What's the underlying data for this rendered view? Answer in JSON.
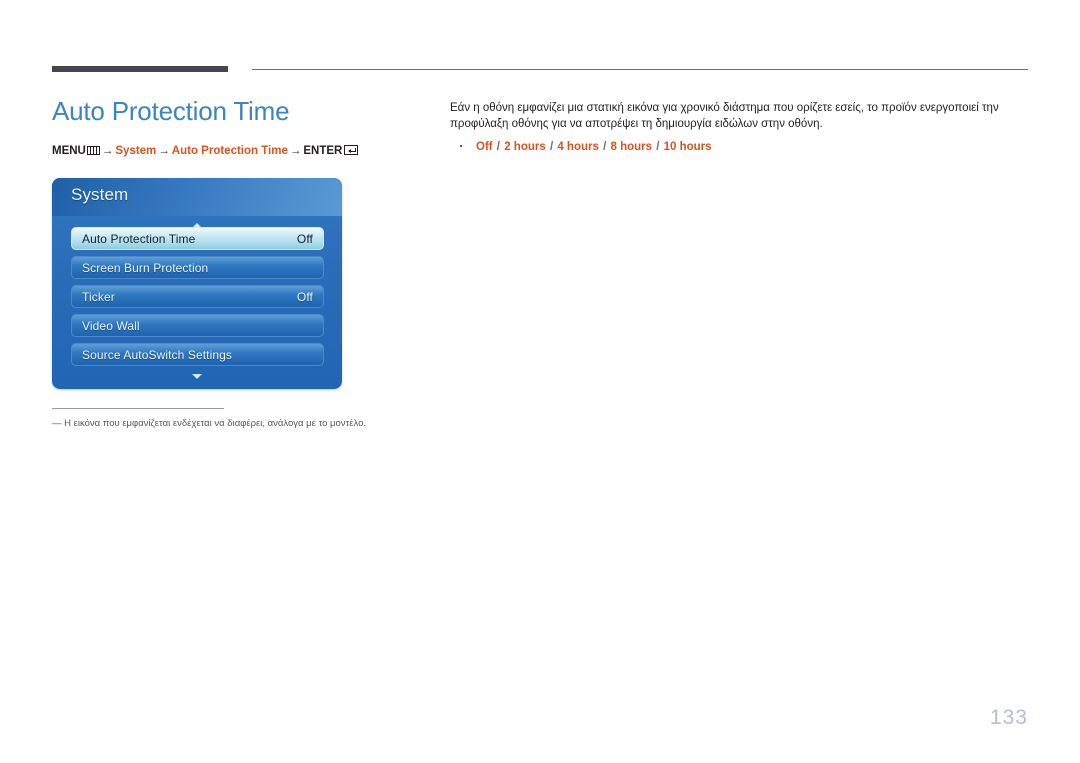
{
  "header": {
    "rule_thick_color": "#474452",
    "rule_thin_color": "#6f6d77"
  },
  "page": {
    "title": "Auto Protection Time",
    "title_color": "#3d85c0",
    "number": "133"
  },
  "menu_path": {
    "root_label": "MENU",
    "menu_icon": "menu-grid-icon",
    "arrow": "→",
    "step1": "System",
    "step2": "Auto Protection Time",
    "enter_label": "ENTER",
    "enter_icon": "enter-return-icon",
    "highlight_color": "#d9531e"
  },
  "osd": {
    "panel_title": "System",
    "scroll_up_icon": "triangle-up-icon",
    "scroll_down_icon": "triangle-down-icon",
    "rows": [
      {
        "label": "Auto Protection Time",
        "value": "Off",
        "selected": true
      },
      {
        "label": "Screen Burn Protection",
        "value": "",
        "selected": false
      },
      {
        "label": "Ticker",
        "value": "Off",
        "selected": false
      },
      {
        "label": "Video Wall",
        "value": "",
        "selected": false
      },
      {
        "label": "Source AutoSwitch Settings",
        "value": "",
        "selected": false
      }
    ]
  },
  "footnote": {
    "text": "― Η εικόνα που εμφανίζεται ενδέχεται να διαφέρει, ανάλογα με το μοντέλο."
  },
  "description": {
    "paragraph": "Εάν η οθόνη εμφανίζει μια στατική εικόνα για χρονικό διάστημα που ορίζετε εσείς, το προϊόν ενεργοποιεί την προφύλαξη οθόνης για να αποτρέψει τη δημιουργία ειδώλων στην οθόνη.",
    "bullet_icon": "bullet-dot-icon",
    "options": [
      "Off",
      "2 hours",
      "4 hours",
      "8 hours",
      "10 hours"
    ],
    "separator": "/"
  }
}
